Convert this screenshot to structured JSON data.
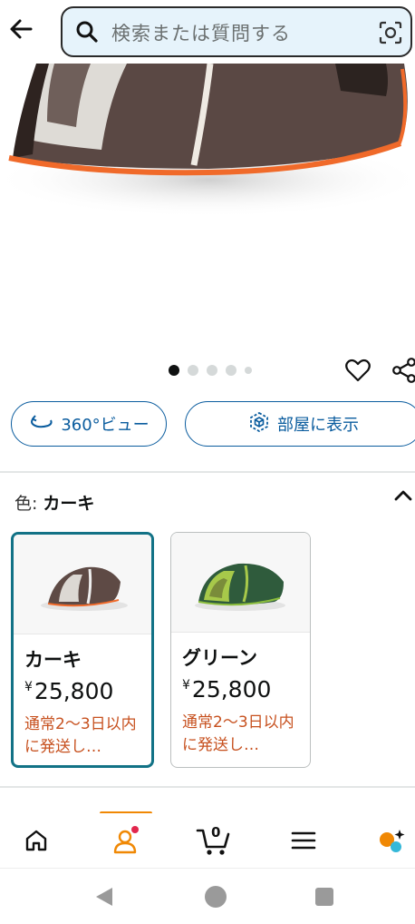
{
  "search": {
    "placeholder": "検索または質問する"
  },
  "gallery": {
    "image_count": 5,
    "active_index": 0
  },
  "view_buttons": {
    "view_360_label": "360°ビュー",
    "view_in_room_label": "部屋に表示"
  },
  "color_selector": {
    "label": "色:",
    "selected_value": "カーキ",
    "options": [
      {
        "name": "カーキ",
        "price": "25,800",
        "currency": "¥",
        "shipping": "通常2〜3日以内に発送し…",
        "selected": true
      },
      {
        "name": "グリーン",
        "price": "25,800",
        "currency": "¥",
        "shipping": "通常2〜3日以内に発送し…",
        "selected": false
      }
    ]
  },
  "bottom_nav": {
    "cart_count": "0",
    "items": [
      "home-icon",
      "account-icon",
      "cart-icon",
      "menu-icon",
      "rufus-icon"
    ]
  },
  "colors": {
    "accent_blue": "#0a5c9e",
    "selected_border": "#127286",
    "shipping_orange": "#c7511f",
    "nav_indicator": "#f08804",
    "search_bg": "#e6f3fb"
  }
}
